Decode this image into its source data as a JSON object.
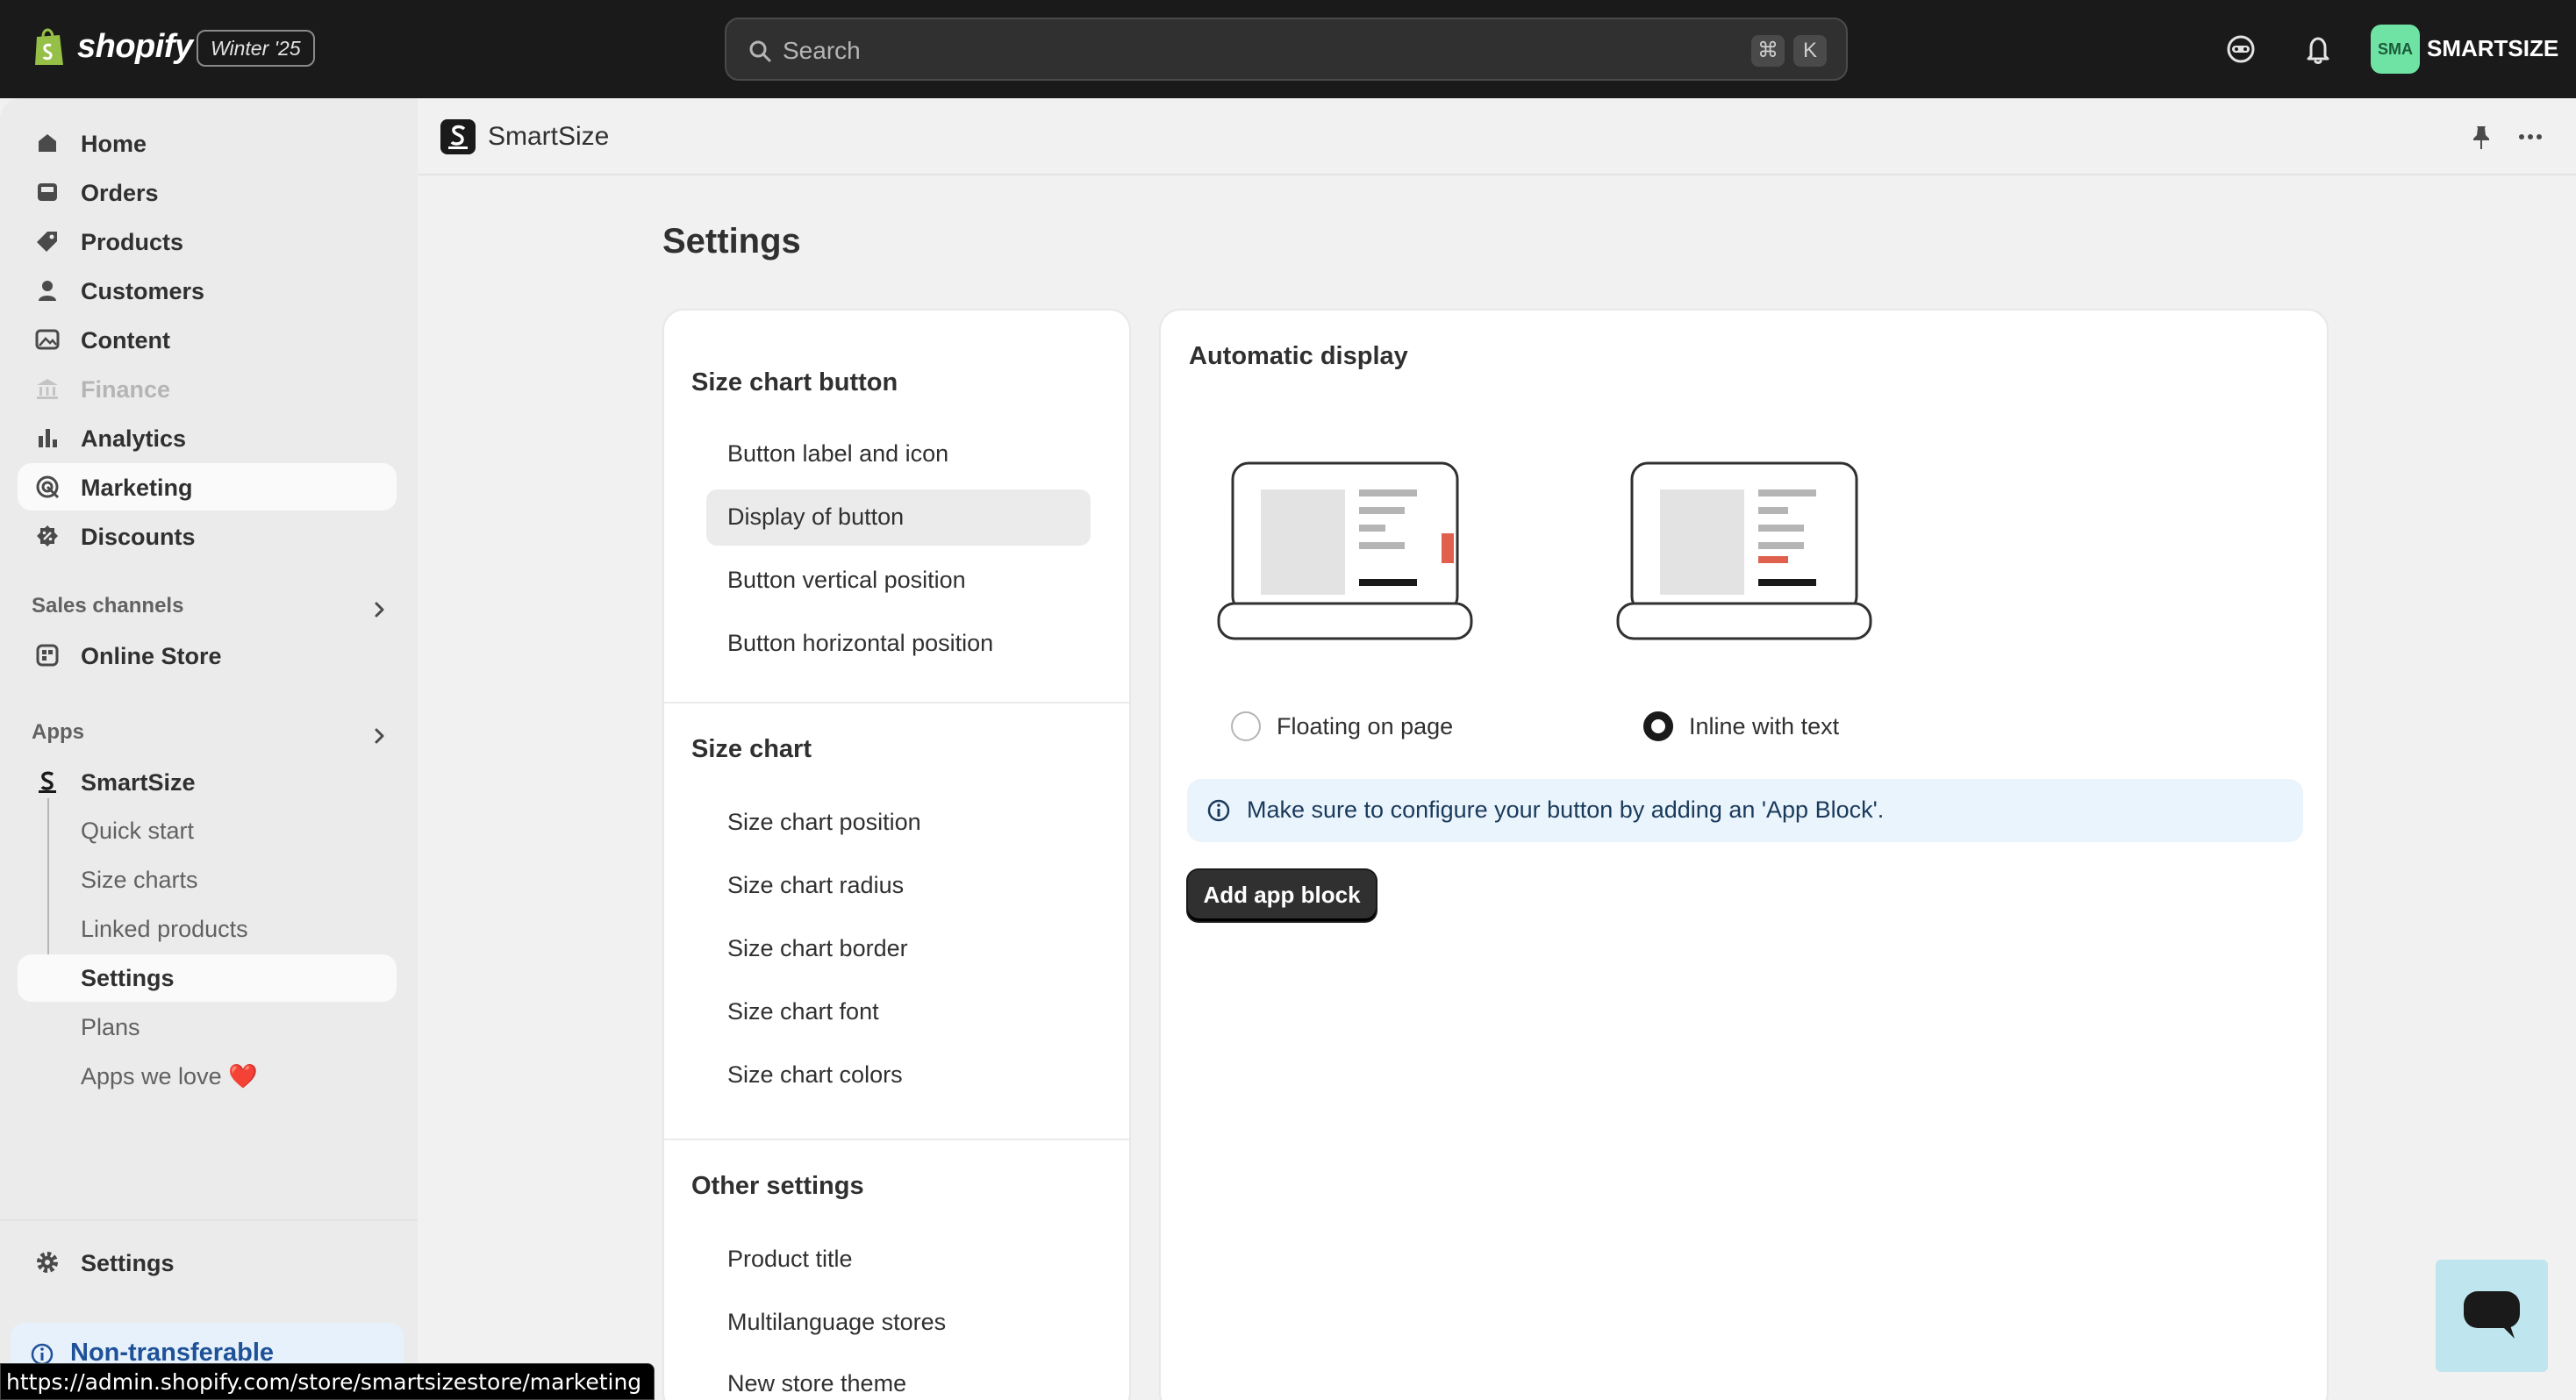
{
  "topbar": {
    "brand": "shopify",
    "edition": "Winter '25",
    "search_placeholder": "Search",
    "shortcut_keys": [
      "⌘",
      "K"
    ],
    "avatar_initials": "SMA",
    "store_name": "SMARTSIZE"
  },
  "sidebar": {
    "items": [
      {
        "label": "Home",
        "icon": "home-icon"
      },
      {
        "label": "Orders",
        "icon": "inbox-icon"
      },
      {
        "label": "Products",
        "icon": "tag-icon"
      },
      {
        "label": "Customers",
        "icon": "person-icon"
      },
      {
        "label": "Content",
        "icon": "image-icon"
      },
      {
        "label": "Finance",
        "icon": "bank-icon"
      },
      {
        "label": "Analytics",
        "icon": "bar-chart-icon"
      },
      {
        "label": "Marketing",
        "icon": "target-icon"
      },
      {
        "label": "Discounts",
        "icon": "discount-icon"
      }
    ],
    "sales_channels_label": "Sales channels",
    "online_store_label": "Online Store",
    "apps_label": "Apps",
    "app_name": "SmartSize",
    "app_subitems": [
      "Quick start",
      "Size charts",
      "Linked products",
      "Settings",
      "Plans",
      "Apps we love ❤️"
    ],
    "settings_label": "Settings",
    "notice_label": "Non-transferable"
  },
  "status_url": "https://admin.shopify.com/store/smartsizestore/marketing",
  "app_header": {
    "title": "SmartSize"
  },
  "page": {
    "title": "Settings"
  },
  "settings_menu": {
    "groups": [
      {
        "title": "Size chart button",
        "items": [
          "Button label and icon",
          "Display of button",
          "Button vertical position",
          "Button horizontal position"
        ]
      },
      {
        "title": "Size chart",
        "items": [
          "Size chart position",
          "Size chart radius",
          "Size chart border",
          "Size chart font",
          "Size chart colors"
        ]
      },
      {
        "title": "Other settings",
        "items": [
          "Product title",
          "Multilanguage stores",
          "New store theme"
        ]
      }
    ],
    "active_item": "Display of button"
  },
  "content": {
    "title": "Automatic display",
    "options": [
      {
        "label": "Floating on page",
        "selected": false
      },
      {
        "label": "Inline with text",
        "selected": true
      }
    ],
    "banner_text": "Make sure to configure your button by adding an 'App Block'.",
    "button_label": "Add app block"
  },
  "colors": {
    "accent_red": "#e0604e",
    "topbar": "#1a1a1a",
    "avatar": "#6fe3a4"
  }
}
